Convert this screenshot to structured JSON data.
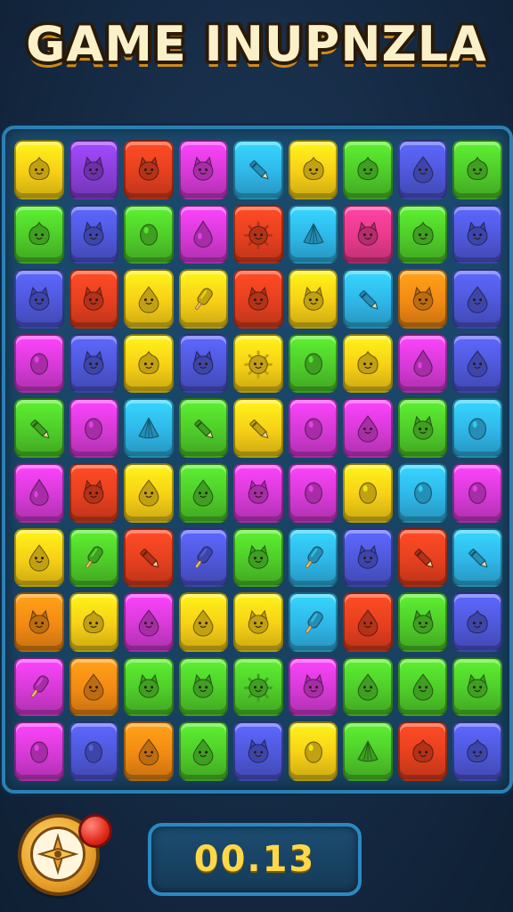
{
  "title": "GAME INUPNZLA",
  "timer": "00.13",
  "board": {
    "columns": 9,
    "rows": 10,
    "tiles": [
      [
        "yellow",
        "purple",
        "red",
        "magenta",
        "cyan",
        "yellow",
        "green",
        "blue",
        "green"
      ],
      [
        "green",
        "blue",
        "green",
        "magenta",
        "red",
        "cyan",
        "pink",
        "green",
        "blue"
      ],
      [
        "blue",
        "red",
        "yellow",
        "yellow",
        "red",
        "yellow",
        "cyan",
        "orange",
        "blue"
      ],
      [
        "magenta",
        "blue",
        "yellow",
        "blue",
        "yellow",
        "green",
        "yellow",
        "magenta",
        "blue"
      ],
      [
        "green",
        "magenta",
        "cyan",
        "green",
        "yellow",
        "magenta",
        "magenta",
        "green",
        "cyan"
      ],
      [
        "magenta",
        "red",
        "yellow",
        "green",
        "magenta",
        "magenta",
        "yellow",
        "cyan",
        "magenta"
      ],
      [
        "yellow",
        "green",
        "red",
        "blue",
        "green",
        "cyan",
        "blue",
        "red",
        "cyan"
      ],
      [
        "orange",
        "yellow",
        "magenta",
        "yellow",
        "yellow",
        "cyan",
        "red",
        "green",
        "blue"
      ],
      [
        "magenta",
        "orange",
        "green",
        "green",
        "green",
        "magenta",
        "green",
        "green",
        "green"
      ],
      [
        "magenta",
        "blue",
        "orange",
        "green",
        "blue",
        "yellow",
        "green",
        "red",
        "blue"
      ]
    ],
    "pieces": [
      [
        "blob-creature",
        "cat-creature",
        "cat-creature",
        "cat-creature",
        "crayon",
        "blob-creature",
        "blob-creature",
        "drop-creature",
        "blob-creature"
      ],
      [
        "blob-creature",
        "cat-creature",
        "egg",
        "drop",
        "sun-creature",
        "shell",
        "cat-creature",
        "blob-creature",
        "cat-creature"
      ],
      [
        "cat-creature",
        "cat-creature",
        "drop-creature",
        "popsicle",
        "cat-creature",
        "cat-creature",
        "crayon",
        "cat-creature",
        "drop-creature"
      ],
      [
        "egg",
        "cat-creature",
        "blob-creature",
        "cat-creature",
        "sun-creature",
        "egg",
        "blob-creature",
        "drop",
        "drop-creature"
      ],
      [
        "crayon",
        "egg",
        "shell",
        "crayon",
        "crayon",
        "egg",
        "drop-creature",
        "cat-creature",
        "egg"
      ],
      [
        "drop",
        "cat-creature",
        "drop-creature",
        "drop-creature",
        "cat-creature",
        "egg",
        "egg",
        "egg",
        "egg"
      ],
      [
        "drop-creature",
        "popsicle",
        "crayon",
        "popsicle",
        "cat-creature",
        "popsicle",
        "cat-creature",
        "crayon",
        "crayon"
      ],
      [
        "cat-creature",
        "blob-creature",
        "drop-creature",
        "drop-creature",
        "cat-creature",
        "popsicle",
        "drop-creature",
        "cat-creature",
        "blob-creature"
      ],
      [
        "popsicle",
        "drop-creature",
        "cat-creature",
        "cat-creature",
        "sun-creature",
        "cat-creature",
        "drop-creature",
        "drop-creature",
        "cat-creature"
      ],
      [
        "egg",
        "egg",
        "drop-creature",
        "drop-creature",
        "cat-creature",
        "egg",
        "shell",
        "blob-creature",
        "blob-creature"
      ]
    ]
  },
  "colors": {
    "yellow": "#f7cf16",
    "purple": "#8a3fd9",
    "red": "#e6401f",
    "magenta": "#d63ad6",
    "cyan": "#2fb6e8",
    "green": "#4fcc2a",
    "blue": "#4f58d9",
    "pink": "#e83a8c",
    "orange": "#f28a14"
  },
  "compass_icon": "compass-icon",
  "alert_icon": "notification-dot-icon"
}
